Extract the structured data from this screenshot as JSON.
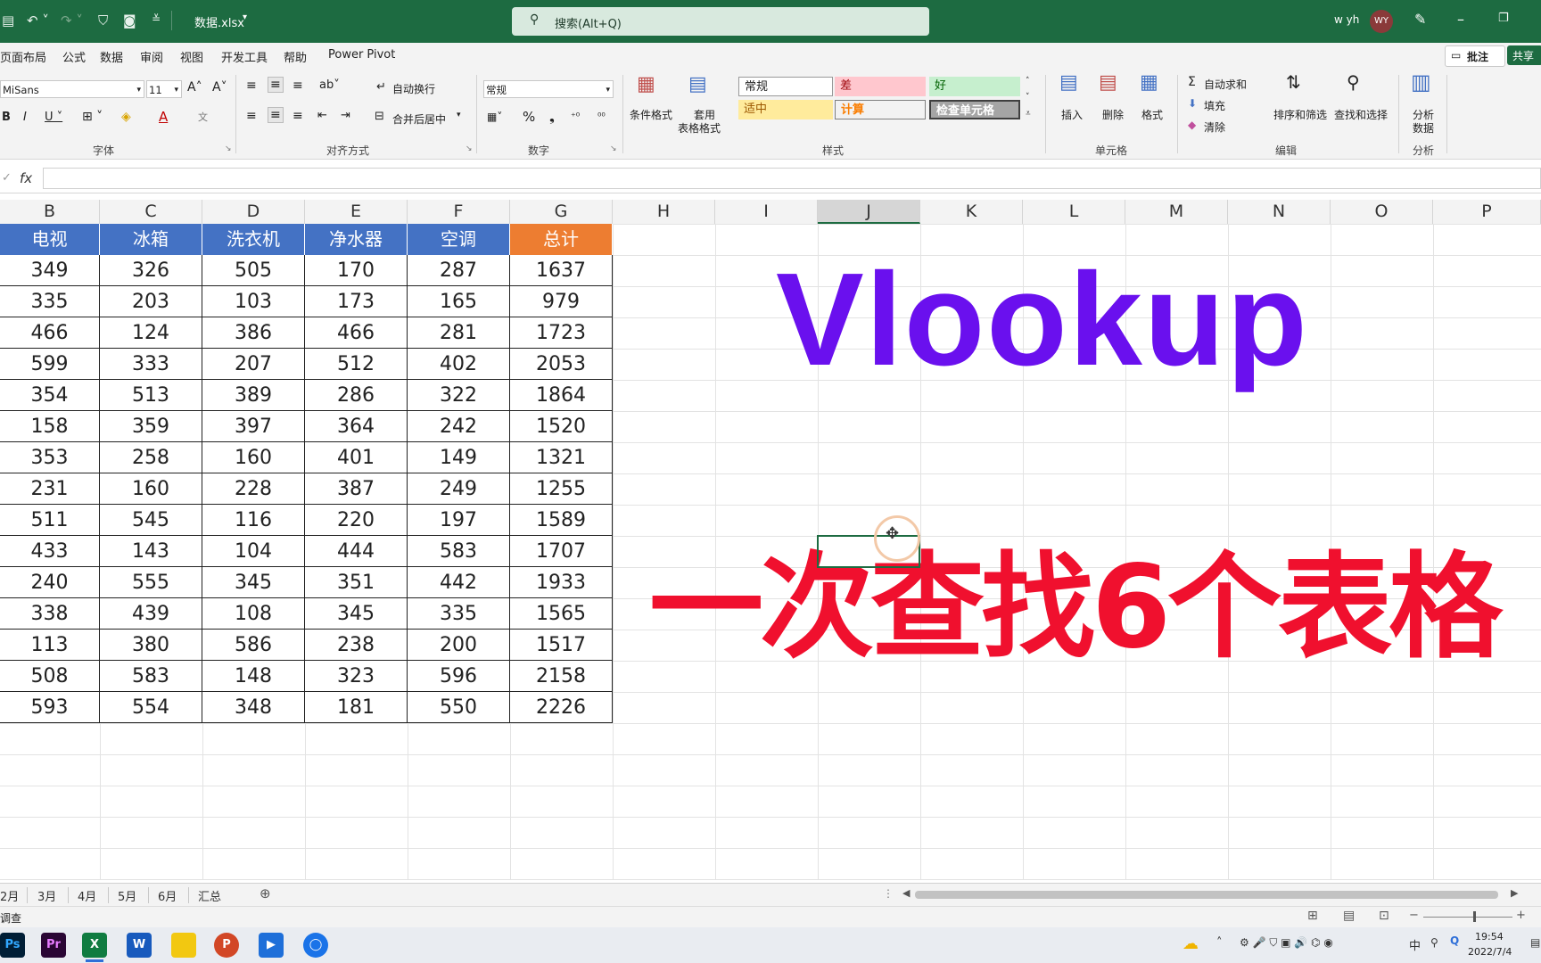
{
  "titlebar": {
    "filename": "数据.xlsx",
    "search_placeholder": "搜索(Alt+Q)",
    "user_name": "w yh",
    "user_initials": "WY"
  },
  "menu": {
    "items": [
      "页面布局",
      "公式",
      "数据",
      "审阅",
      "视图",
      "开发工具",
      "帮助",
      "Power Pivot"
    ],
    "comment_button": "批注",
    "share_button": "共享"
  },
  "ribbon": {
    "font": {
      "family": "MiSans",
      "size": "11",
      "label": "字体"
    },
    "alignment": {
      "wrap": "自动换行",
      "merge": "合并后居中",
      "label": "对齐方式"
    },
    "number": {
      "format": "常规",
      "label": "数字"
    },
    "styles": {
      "conditional": "条件格式",
      "table_format_1": "套用",
      "table_format_2": "表格格式",
      "normal": "常规",
      "bad": "差",
      "good": "好",
      "neutral": "适中",
      "calculation": "计算",
      "check_cell": "检查单元格",
      "label": "样式"
    },
    "cells": {
      "insert": "插入",
      "delete": "删除",
      "format": "格式",
      "label": "单元格"
    },
    "editing": {
      "autosum": "自动求和",
      "fill": "填充",
      "clear": "清除",
      "sort": "排序和筛选",
      "find": "查找和选择",
      "label": "编辑"
    },
    "analysis": {
      "analyze_1": "分析",
      "analyze_2": "数据",
      "label": "分析"
    }
  },
  "formula_bar": {
    "fx": "fx",
    "value": ""
  },
  "columns": [
    "B",
    "C",
    "D",
    "E",
    "F",
    "G",
    "H",
    "I",
    "J",
    "K",
    "L",
    "M",
    "N",
    "O",
    "P"
  ],
  "selected_column": "J",
  "table": {
    "headers": [
      "电视",
      "冰箱",
      "洗衣机",
      "净水器",
      "空调",
      "总计"
    ],
    "header_color": "#4472c4",
    "total_header_color": "#ed7d31",
    "rows": [
      [
        "349",
        "326",
        "505",
        "170",
        "287",
        "1637"
      ],
      [
        "335",
        "203",
        "103",
        "173",
        "165",
        "979"
      ],
      [
        "466",
        "124",
        "386",
        "466",
        "281",
        "1723"
      ],
      [
        "599",
        "333",
        "207",
        "512",
        "402",
        "2053"
      ],
      [
        "354",
        "513",
        "389",
        "286",
        "322",
        "1864"
      ],
      [
        "158",
        "359",
        "397",
        "364",
        "242",
        "1520"
      ],
      [
        "353",
        "258",
        "160",
        "401",
        "149",
        "1321"
      ],
      [
        "231",
        "160",
        "228",
        "387",
        "249",
        "1255"
      ],
      [
        "511",
        "545",
        "116",
        "220",
        "197",
        "1589"
      ],
      [
        "433",
        "143",
        "104",
        "444",
        "583",
        "1707"
      ],
      [
        "240",
        "555",
        "345",
        "351",
        "442",
        "1933"
      ],
      [
        "338",
        "439",
        "108",
        "345",
        "335",
        "1565"
      ],
      [
        "113",
        "380",
        "586",
        "238",
        "200",
        "1517"
      ],
      [
        "508",
        "583",
        "148",
        "323",
        "596",
        "2158"
      ],
      [
        "593",
        "554",
        "348",
        "181",
        "550",
        "2226"
      ]
    ]
  },
  "overlay": {
    "title": "Vlookup",
    "subtitle": "一次查找6个表格",
    "title_color": "#6a10ee",
    "subtitle_color": "#f0102e"
  },
  "sheet_tabs": [
    "2月",
    "3月",
    "4月",
    "5月",
    "6月",
    "汇总"
  ],
  "status": {
    "text": "调查"
  },
  "taskbar": {
    "apps": [
      "Ps",
      "Pr",
      "X",
      "W",
      "",
      "P",
      "",
      ""
    ],
    "time": "19:54",
    "date": "2022/7/4",
    "ime": "中"
  }
}
